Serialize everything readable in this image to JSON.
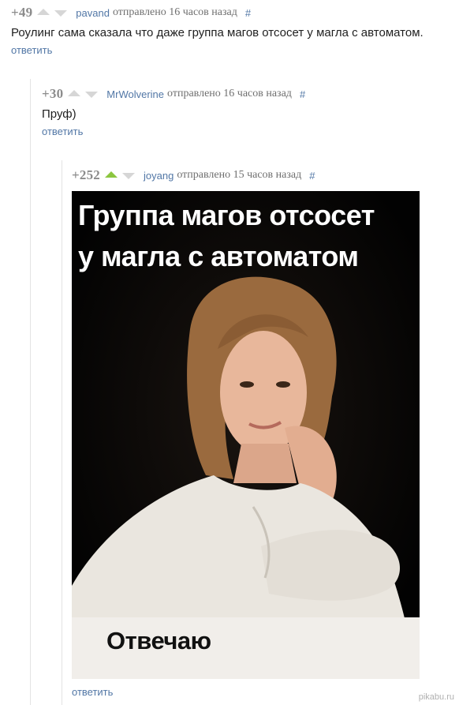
{
  "comments": [
    {
      "rating": "+49",
      "author": "pavand",
      "meta": "отправлено 16 часов назад",
      "hash": "#",
      "text": "Роулинг сама сказала что даже группа магов отсосет у магла с автоматом.",
      "reply": "ответить"
    },
    {
      "rating": "+30",
      "author": "MrWolverine",
      "meta": "отправлено 16 часов назад",
      "hash": "#",
      "text": "Пруф)",
      "reply": "ответить"
    },
    {
      "rating": "+252",
      "author": "joyang",
      "meta": "отправлено 15 часов назад",
      "hash": "#",
      "reply": "ответить",
      "image": {
        "caption_top_line1": "Группа магов отсосет",
        "caption_top_line2": "у магла с автоматом",
        "caption_bottom": "Отвечаю"
      }
    }
  ],
  "watermark": "pikabu.ru",
  "colors": {
    "link": "#5277a6",
    "rating": "#8c8c8c",
    "vote_inactive": "#d6d6d6",
    "vote_active": "#8cc63f"
  }
}
